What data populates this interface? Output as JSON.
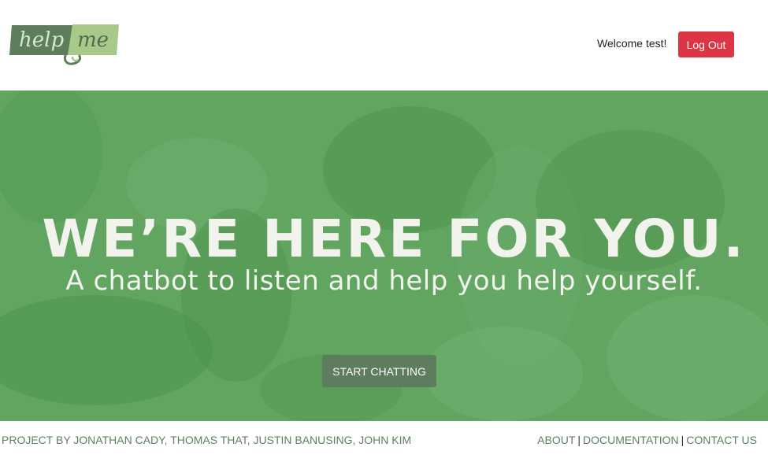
{
  "header": {
    "logo": {
      "word1": "help",
      "word2": "me",
      "colors": {
        "dark": "#5e7d5c",
        "light": "#a9c98a"
      }
    },
    "welcome_text": "Welcome test!",
    "logout_label": "Log Out"
  },
  "hero": {
    "title": "WE’RE HERE FOR YOU.",
    "subtitle": "A chatbot to listen and help you help yourself.",
    "cta_label": "START CHATTING",
    "background_color": "#5ea35e"
  },
  "footer": {
    "credits": "PROJECT BY JONATHAN CADY, THOMAS THAT, JUSTIN BANUSING, JOHN KIM",
    "links": [
      "ABOUT",
      "DOCUMENTATION",
      "CONTACT US"
    ],
    "separator": "|"
  },
  "colors": {
    "accent_danger": "#dc3545",
    "cta": "#5e7c5e",
    "footer_text": "#5f7f5f"
  }
}
